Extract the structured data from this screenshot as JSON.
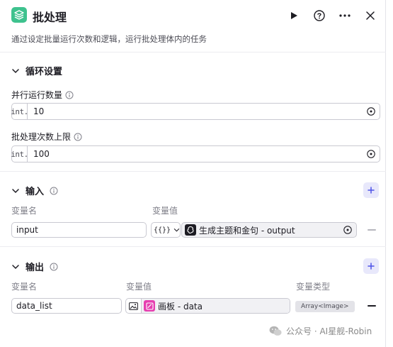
{
  "header": {
    "title": "批处理",
    "description": "通过设定批量运行次数和逻辑，运行批处理体内的任务"
  },
  "loop_settings": {
    "title": "循环设置",
    "parallel": {
      "label": "并行运行数量",
      "type_prefix": "int.",
      "value": "10"
    },
    "batch_limit": {
      "label": "批处理次数上限",
      "type_prefix": "int.",
      "value": "100"
    }
  },
  "input": {
    "title": "输入",
    "col_name": "变量名",
    "col_value": "变量值",
    "rows": [
      {
        "name": "input",
        "ref_mode": "{{}}",
        "ref_label": "生成主题和金句 - output"
      }
    ]
  },
  "output": {
    "title": "输出",
    "col_name": "变量名",
    "col_value": "变量值",
    "col_type": "变量类型",
    "rows": [
      {
        "name": "data_list",
        "ref_label": "画板 - data",
        "type": "Array<Image>"
      }
    ]
  },
  "watermark": {
    "text": "公众号 · AI星舰-Robin"
  },
  "colors": {
    "accent": "#3ec28e",
    "add_button": "#e8e8fb",
    "add_icon": "#4d53e8"
  }
}
